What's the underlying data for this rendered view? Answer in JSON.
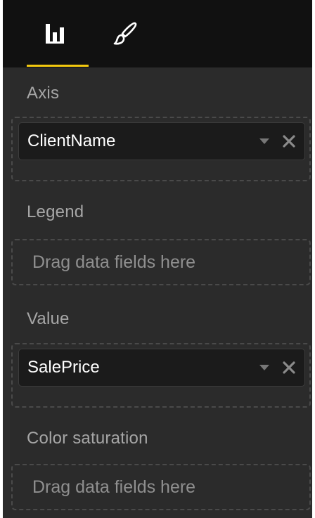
{
  "tabs": [
    {
      "id": "fields",
      "icon": "bar-chart-icon",
      "active": true
    },
    {
      "id": "format",
      "icon": "paintbrush-icon",
      "active": false
    }
  ],
  "wells": {
    "axis": {
      "label": "Axis",
      "field": "ClientName"
    },
    "legend": {
      "label": "Legend",
      "placeholder": "Drag data fields here"
    },
    "value": {
      "label": "Value",
      "field": "SalePrice"
    },
    "color_saturation": {
      "label": "Color saturation",
      "placeholder": "Drag data fields here"
    }
  },
  "colors": {
    "panel_background": "#2b2b2b",
    "tab_bar_background": "#111111",
    "active_tab_accent": "#f2c80f",
    "label_text": "#a6a6a6",
    "field_text": "#ffffff",
    "placeholder_text": "#8f8f8f"
  }
}
